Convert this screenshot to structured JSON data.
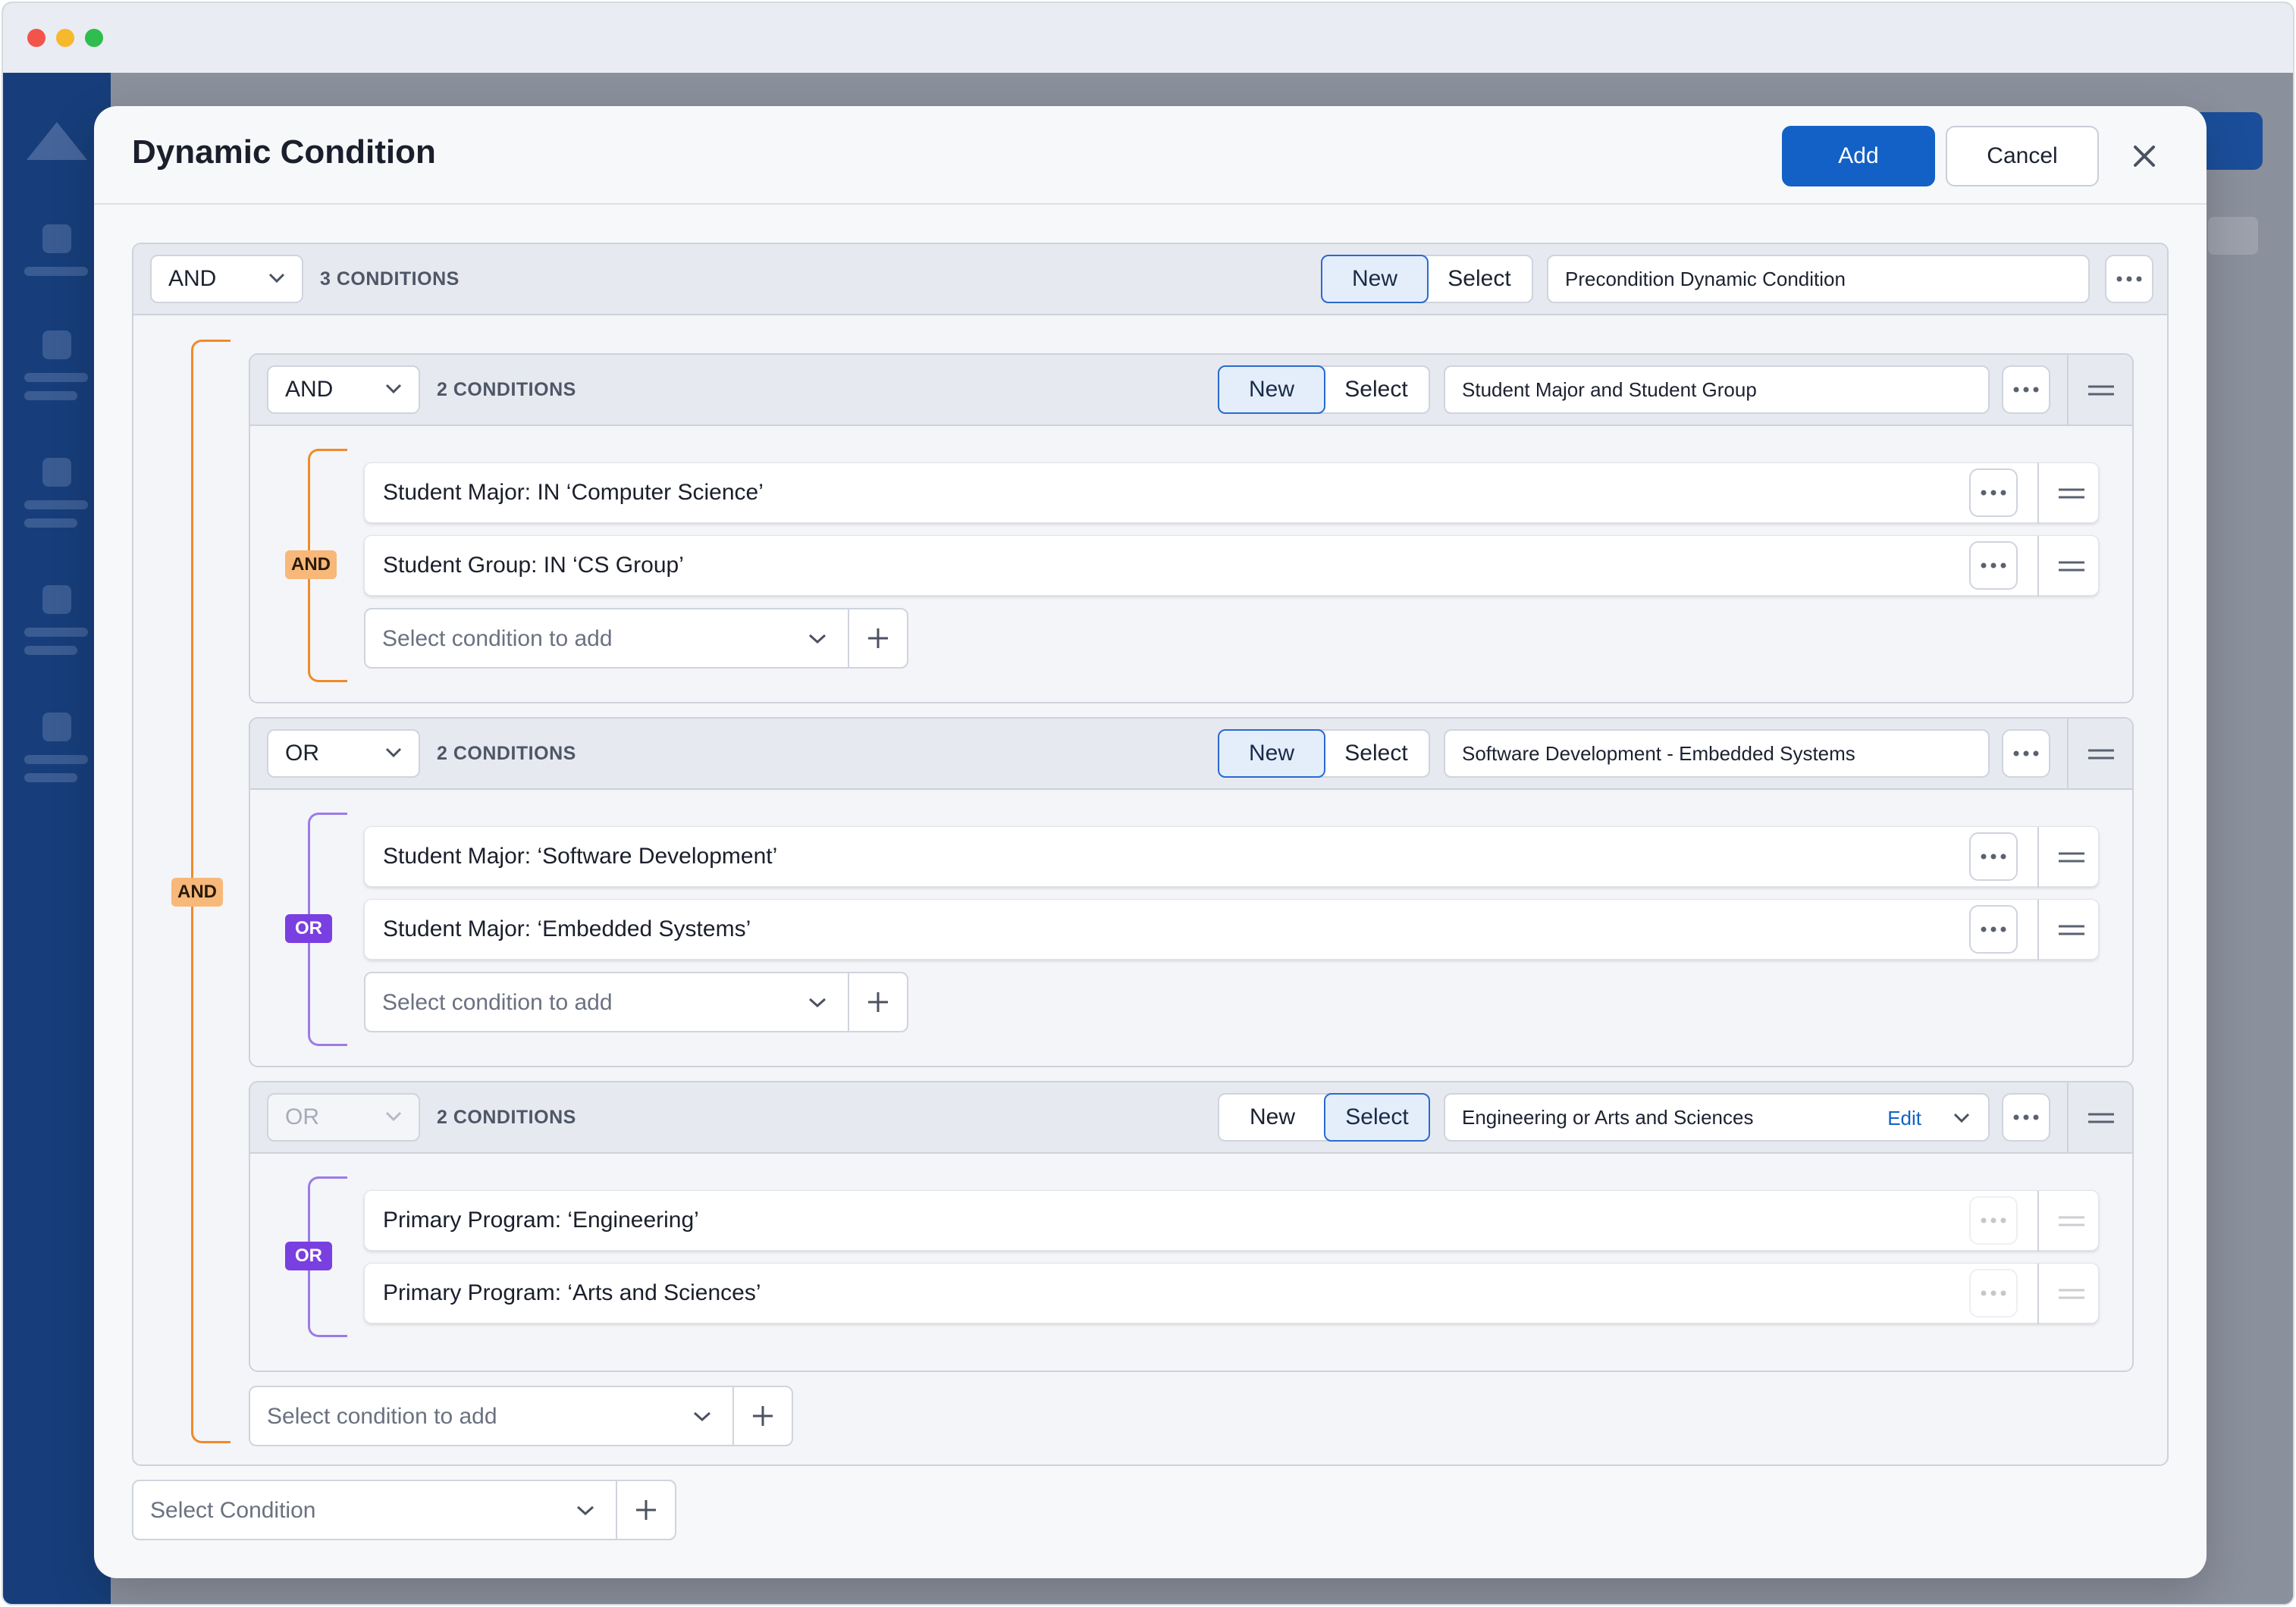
{
  "modal": {
    "title": "Dynamic Condition",
    "add_label": "Add",
    "cancel_label": "Cancel"
  },
  "colors": {
    "primary": "#1361c6",
    "and_badge": "#f7b87a",
    "or_badge": "#7a3fe0",
    "and_bracket": "#f08a2a",
    "or_bracket": "#9b7be6"
  },
  "root": {
    "operator": "AND",
    "count": "3 CONDITIONS",
    "toggle": {
      "new": "New",
      "select": "Select",
      "active": "new"
    },
    "name": "Precondition Dynamic Condition",
    "badge": "AND",
    "groups": [
      {
        "operator": "AND",
        "count": "2 CONDITIONS",
        "toggle": {
          "new": "New",
          "select": "Select",
          "active": "new"
        },
        "name": "Student Major and Student Group",
        "badge": "AND",
        "conditions": [
          "Student Major: IN ‘Computer Science’",
          "Student Group: IN ‘CS Group’"
        ],
        "add_placeholder": "Select condition to add"
      },
      {
        "operator": "OR",
        "count": "2 CONDITIONS",
        "toggle": {
          "new": "New",
          "select": "Select",
          "active": "new"
        },
        "name": "Software Development - Embedded Systems",
        "badge": "OR",
        "conditions": [
          "Student Major: ‘Software Development’",
          "Student Major: ‘Embedded Systems’"
        ],
        "add_placeholder": "Select condition to add"
      },
      {
        "operator": "OR",
        "count": "2 CONDITIONS",
        "toggle": {
          "new": "New",
          "select": "Select",
          "active": "select"
        },
        "name": "Engineering or Arts and Sciences",
        "edit_label": "Edit",
        "badge": "OR",
        "conditions": [
          "Primary Program: ‘Engineering’",
          "Primary Program: ‘Arts and Sciences’"
        ]
      }
    ],
    "add_placeholder": "Select condition to add"
  },
  "bottom_select_placeholder": "Select Condition"
}
